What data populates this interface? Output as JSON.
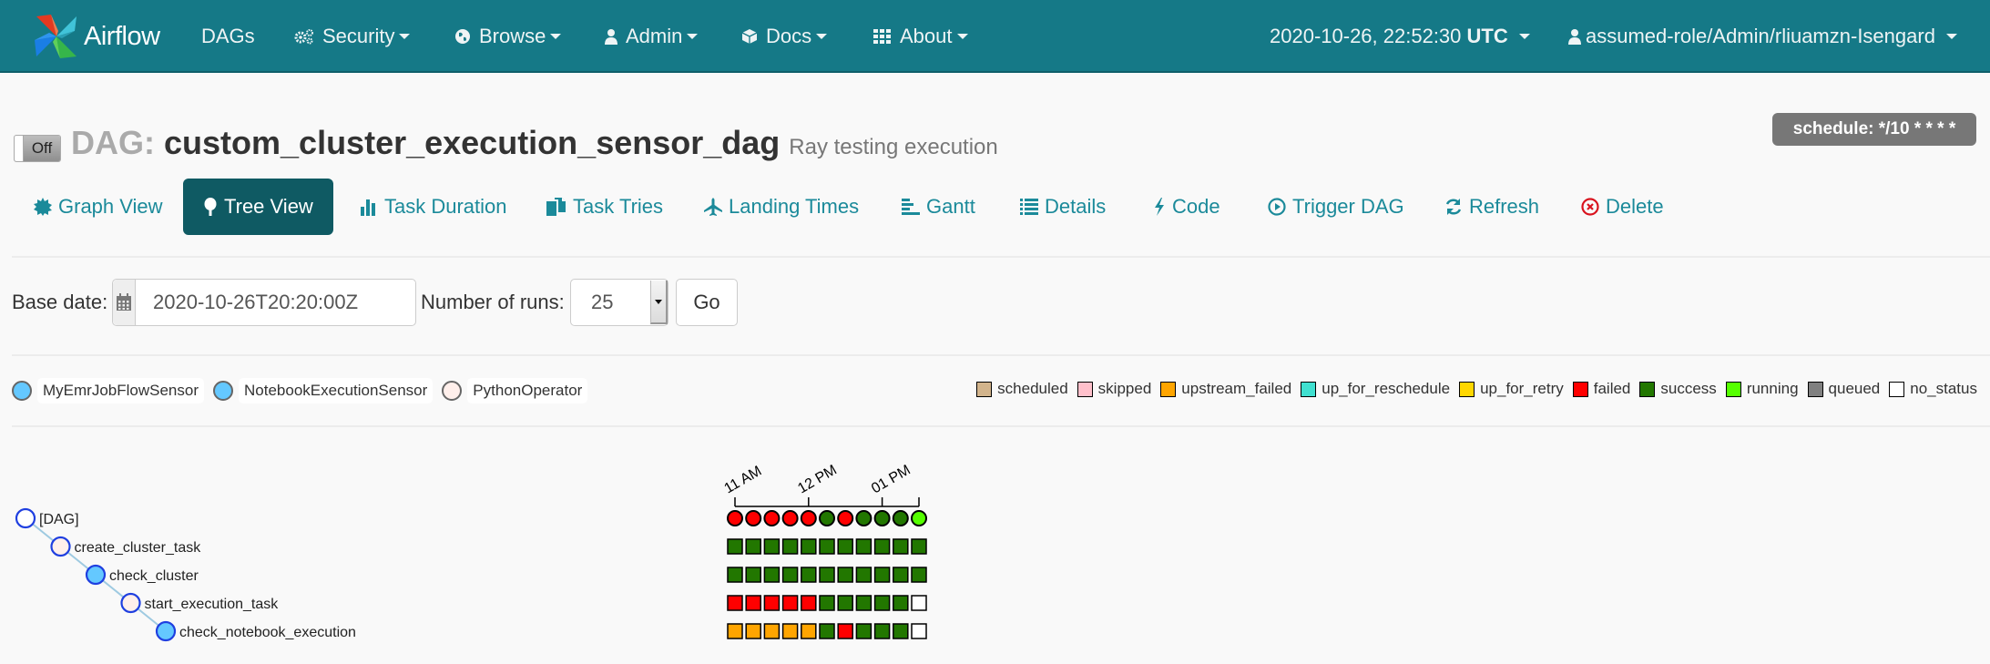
{
  "navbar": {
    "brand": "Airflow",
    "items": [
      {
        "label": "DAGs",
        "icon": "none",
        "dropdown": false
      },
      {
        "label": "Security",
        "icon": "cogs-icon",
        "dropdown": true
      },
      {
        "label": "Browse",
        "icon": "globe-icon",
        "dropdown": true
      },
      {
        "label": "Admin",
        "icon": "user-icon",
        "dropdown": true
      },
      {
        "label": "Docs",
        "icon": "cube-icon",
        "dropdown": true
      },
      {
        "label": "About",
        "icon": "grid-icon",
        "dropdown": true
      }
    ],
    "time": "2020-10-26, 22:52:30",
    "timezone": "UTC",
    "user": "assumed-role/Admin/rliuamzn-Isengard"
  },
  "header": {
    "toggle_label": "Off",
    "dag_prefix": "DAG:",
    "dag_id": "custom_cluster_execution_sensor_dag",
    "description": "Ray testing execution",
    "schedule": "schedule: */10 * * * *"
  },
  "tabs": [
    {
      "label": "Graph View",
      "icon": "graph-icon",
      "active": false
    },
    {
      "label": "Tree View",
      "icon": "tree-icon",
      "active": true
    },
    {
      "label": "Task Duration",
      "icon": "bar-chart-icon",
      "active": false
    },
    {
      "label": "Task Tries",
      "icon": "files-icon",
      "active": false
    },
    {
      "label": "Landing Times",
      "icon": "plane-icon",
      "active": false
    },
    {
      "label": "Gantt",
      "icon": "gantt-icon",
      "active": false
    },
    {
      "label": "Details",
      "icon": "list-icon",
      "active": false
    },
    {
      "label": "Code",
      "icon": "flash-icon",
      "active": false
    },
    {
      "label": "Trigger DAG",
      "icon": "play-circle-icon",
      "active": false
    },
    {
      "label": "Refresh",
      "icon": "refresh-icon",
      "active": false
    },
    {
      "label": "Delete",
      "icon": "remove-circle-icon",
      "active": false
    }
  ],
  "filters": {
    "base_date_label": "Base date:",
    "base_date_value": "2020-10-26T20:20:00Z",
    "runs_label": "Number of runs:",
    "runs_value": "25",
    "go_label": "Go"
  },
  "operators": [
    {
      "label": "MyEmrJobFlowSensor",
      "color": "#64c8ff"
    },
    {
      "label": "NotebookExecutionSensor",
      "color": "#64c8ff"
    },
    {
      "label": "PythonOperator",
      "color": "#ffefeb"
    }
  ],
  "states": [
    {
      "label": "scheduled",
      "color": "#d2b48c"
    },
    {
      "label": "skipped",
      "color": "#ffc0cb"
    },
    {
      "label": "upstream_failed",
      "color": "#ffa500"
    },
    {
      "label": "up_for_reschedule",
      "color": "#40e0d0"
    },
    {
      "label": "up_for_retry",
      "color": "#ffd700"
    },
    {
      "label": "failed",
      "color": "#ff0000"
    },
    {
      "label": "success",
      "color": "#227700"
    },
    {
      "label": "running",
      "color": "#55ff00"
    },
    {
      "label": "queued",
      "color": "#808080"
    },
    {
      "label": "no_status",
      "color": "#ffffff"
    }
  ],
  "tree": {
    "time_ticks": [
      "11 AM",
      "12 PM",
      "01 PM"
    ],
    "nodes": [
      {
        "label": "[DAG]",
        "depth": 0,
        "fill": "#ffffff"
      },
      {
        "label": "create_cluster_task",
        "depth": 1,
        "fill": "#ffefeb"
      },
      {
        "label": "check_cluster",
        "depth": 2,
        "fill": "#64c8ff"
      },
      {
        "label": "start_execution_task",
        "depth": 3,
        "fill": "#ffefeb"
      },
      {
        "label": "check_notebook_execution",
        "depth": 4,
        "fill": "#64c8ff"
      }
    ],
    "dag_runs": [
      "failed",
      "failed",
      "failed",
      "failed",
      "failed",
      "success",
      "failed",
      "success",
      "success",
      "success",
      "running"
    ],
    "task_instances": [
      [
        "success",
        "success",
        "success",
        "success",
        "success",
        "success",
        "success",
        "success",
        "success",
        "success",
        "success"
      ],
      [
        "success",
        "success",
        "success",
        "success",
        "success",
        "success",
        "success",
        "success",
        "success",
        "success",
        "success"
      ],
      [
        "failed",
        "failed",
        "failed",
        "failed",
        "failed",
        "success",
        "success",
        "success",
        "success",
        "success",
        "no_status"
      ],
      [
        "upstream_failed",
        "upstream_failed",
        "upstream_failed",
        "upstream_failed",
        "upstream_failed",
        "success",
        "failed",
        "success",
        "success",
        "success",
        "no_status"
      ]
    ]
  }
}
